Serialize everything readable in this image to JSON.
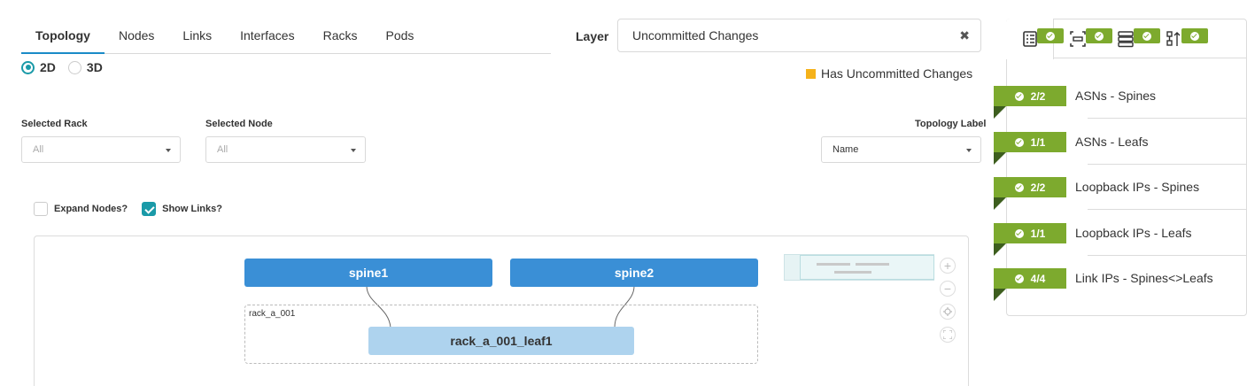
{
  "tabs": [
    "Topology",
    "Nodes",
    "Links",
    "Interfaces",
    "Racks",
    "Pods"
  ],
  "view_modes": [
    "2D",
    "3D"
  ],
  "layer": {
    "label": "Layer",
    "value": "Uncommitted Changes",
    "clear_glyph": "✖"
  },
  "legend": {
    "label": "Has Uncommitted Changes",
    "color": "#f5b21a"
  },
  "selected_rack": {
    "label": "Selected Rack",
    "value": "All"
  },
  "selected_node": {
    "label": "Selected Node",
    "value": "All"
  },
  "topology_label": {
    "label": "Topology Label",
    "value": "Name"
  },
  "options": {
    "expand_nodes": "Expand Nodes?",
    "show_links": "Show Links?"
  },
  "topology": {
    "spines": [
      "spine1",
      "spine2"
    ],
    "rack": {
      "name": "rack_a_001",
      "leaf": "rack_a_001_leaf1"
    }
  },
  "zoom_controls": {
    "zoom_in": "+",
    "zoom_out": "−"
  },
  "validation": [
    {
      "count": "2/2",
      "label": "ASNs - Spines"
    },
    {
      "count": "1/1",
      "label": "ASNs - Leafs"
    },
    {
      "count": "2/2",
      "label": "Loopback IPs - Spines"
    },
    {
      "count": "1/1",
      "label": "Loopback IPs - Leafs"
    },
    {
      "count": "4/4",
      "label": "Link IPs - Spines<>Leafs"
    }
  ],
  "colors": {
    "accent": "#1a8bc7",
    "spine": "#3a8fd6",
    "leaf": "#aed3ee",
    "ok": "#7daa2e"
  }
}
